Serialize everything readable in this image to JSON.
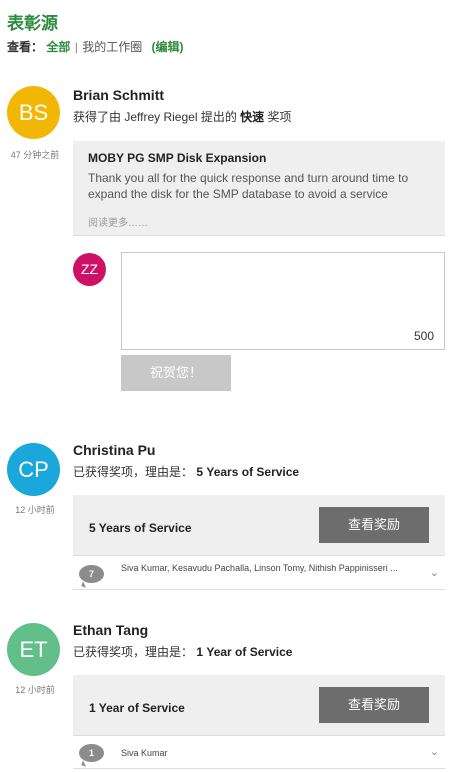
{
  "header": {
    "title": "表彰源",
    "filter_label": "查看：",
    "filter_all": "全部",
    "filter_separator": "|",
    "filter_mine": "我的工作圈",
    "filter_edit": "(编辑)"
  },
  "feed": [
    {
      "initials": "BS",
      "avatar_color": "#f2b705",
      "time": "47 分钟之前",
      "name": "Brian Schmitt",
      "desc_prefix": "获得了由 Jeffrey Riegel 提出的",
      "award_name": "快速",
      "desc_suffix": "奖项",
      "card_title": "MOBY PG SMP Disk Expansion",
      "card_body": "Thank you all for the quick response and turn around time to expand the disk for the SMP database to avoid a service",
      "read_more": "阅读更多……",
      "comment": {
        "user_initials": "ZZ",
        "placeholder": "",
        "char_count": "500",
        "submit_label": "祝贺您！"
      }
    },
    {
      "initials": "CP",
      "avatar_color": "#1aa7d9",
      "time": "12 小时前",
      "name": "Christina Pu",
      "desc_prefix": "已获得奖项，理由是：",
      "award_name": "5 Years of Service",
      "card_title": "5 Years of Service",
      "view_label": "查看奖励",
      "cheer_count": "7",
      "cheer_names": "Siva Kumar, Kesavudu Pachalla, Linson Tomy, Nithish Pappinisseri ..."
    },
    {
      "initials": "ET",
      "avatar_color": "#63bf8a",
      "time": "12 小时前",
      "name": "Ethan Tang",
      "desc_prefix": "已获得奖项，理由是：",
      "award_name": "1 Year of Service",
      "card_title": "1 Year of Service",
      "view_label": "查看奖励",
      "cheer_count": "1",
      "cheer_names": "Siva Kumar"
    }
  ],
  "icons": {
    "expand": "chevron-down-icon",
    "cheers": "speech-bubble-icon"
  }
}
